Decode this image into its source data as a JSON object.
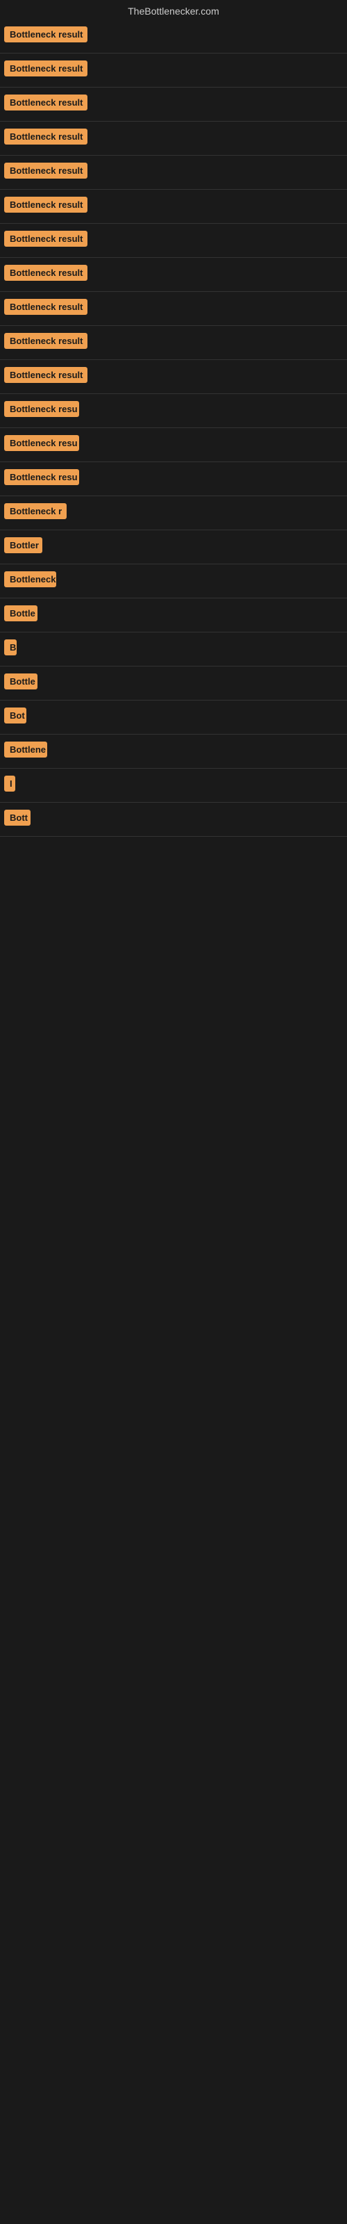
{
  "site": {
    "title": "TheBottlenecker.com"
  },
  "cards": [
    {
      "id": 1,
      "label": "Bottleneck result",
      "badge_width": 120
    },
    {
      "id": 2,
      "label": "Bottleneck result",
      "badge_width": 120
    },
    {
      "id": 3,
      "label": "Bottleneck result",
      "badge_width": 120
    },
    {
      "id": 4,
      "label": "Bottleneck result",
      "badge_width": 120
    },
    {
      "id": 5,
      "label": "Bottleneck result",
      "badge_width": 120
    },
    {
      "id": 6,
      "label": "Bottleneck result",
      "badge_width": 120
    },
    {
      "id": 7,
      "label": "Bottleneck result",
      "badge_width": 120
    },
    {
      "id": 8,
      "label": "Bottleneck result",
      "badge_width": 120
    },
    {
      "id": 9,
      "label": "Bottleneck result",
      "badge_width": 120
    },
    {
      "id": 10,
      "label": "Bottleneck result",
      "badge_width": 120
    },
    {
      "id": 11,
      "label": "Bottleneck result",
      "badge_width": 120
    },
    {
      "id": 12,
      "label": "Bottleneck resu",
      "badge_width": 108
    },
    {
      "id": 13,
      "label": "Bottleneck resu",
      "badge_width": 108
    },
    {
      "id": 14,
      "label": "Bottleneck resu",
      "badge_width": 108
    },
    {
      "id": 15,
      "label": "Bottleneck r",
      "badge_width": 90
    },
    {
      "id": 16,
      "label": "Bottler",
      "badge_width": 55
    },
    {
      "id": 17,
      "label": "Bottleneck",
      "badge_width": 75
    },
    {
      "id": 18,
      "label": "Bottle",
      "badge_width": 48
    },
    {
      "id": 19,
      "label": "B",
      "badge_width": 18
    },
    {
      "id": 20,
      "label": "Bottle",
      "badge_width": 48
    },
    {
      "id": 21,
      "label": "Bot",
      "badge_width": 32
    },
    {
      "id": 22,
      "label": "Bottlene",
      "badge_width": 62
    },
    {
      "id": 23,
      "label": "I",
      "badge_width": 12
    },
    {
      "id": 24,
      "label": "Bott",
      "badge_width": 38
    }
  ]
}
